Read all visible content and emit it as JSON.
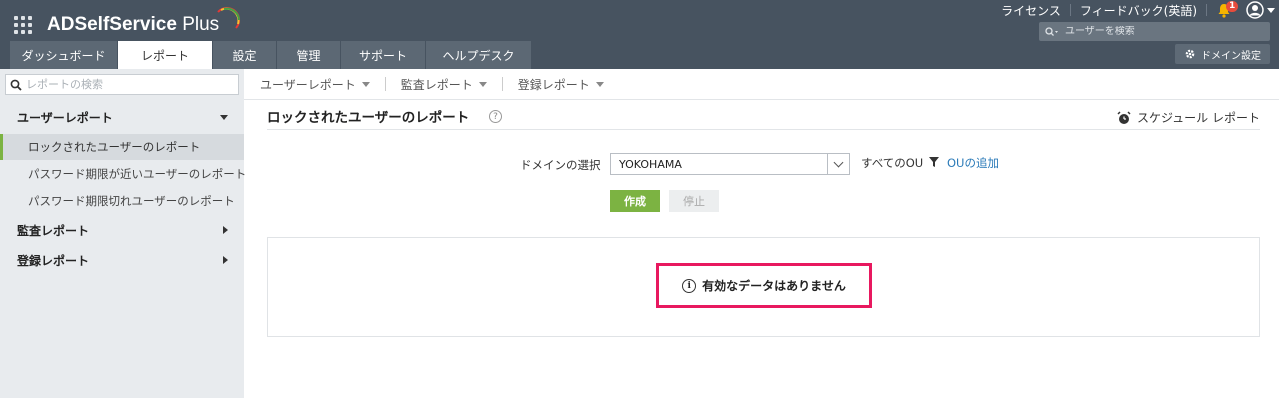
{
  "header": {
    "product_name": "ADSelfService",
    "product_suffix": "Plus",
    "links": {
      "license": "ライセンス",
      "feedback": "フィードバック(英語)"
    },
    "notification_count": "1",
    "user_search_placeholder": "ユーザーを検索",
    "domain_settings_label": "ドメイン設定",
    "tabs": [
      {
        "label": "ダッシュボード",
        "active": false
      },
      {
        "label": "レポート",
        "active": true
      },
      {
        "label": "設定",
        "active": false
      },
      {
        "label": "管理",
        "active": false
      },
      {
        "label": "サポート",
        "active": false
      },
      {
        "label": "ヘルプデスク",
        "active": false
      }
    ]
  },
  "sidebar": {
    "search_placeholder": "レポートの検索",
    "groups": [
      {
        "label": "ユーザーレポート",
        "expanded": true,
        "items": [
          {
            "label": "ロックされたユーザーのレポート",
            "active": true
          },
          {
            "label": "パスワード期限が近いユーザーのレポート",
            "active": false
          },
          {
            "label": "パスワード期限切れユーザーのレポート",
            "active": false
          }
        ]
      },
      {
        "label": "監査レポート",
        "expanded": false
      },
      {
        "label": "登録レポート",
        "expanded": false
      }
    ]
  },
  "subnav": {
    "items": [
      "ユーザーレポート",
      "監査レポート",
      "登録レポート"
    ]
  },
  "main": {
    "title": "ロックされたユーザーのレポート",
    "help_glyph": "?",
    "schedule_label": "スケジュール レポート",
    "domain_label": "ドメインの選択",
    "domain_value": "YOKOHAMA",
    "all_ou_label": "すべてのOU",
    "add_ou_label": "OUの追加",
    "create_button": "作成",
    "stop_button": "停止",
    "no_data_message": "有効なデータはありません",
    "info_glyph": "i"
  },
  "colors": {
    "header_bg": "#475360",
    "tab_bg": "#5c6874",
    "sidebar_bg": "#e8ebee",
    "accent_green": "#7cb342",
    "link_blue": "#2a7ab8",
    "highlight_pink": "#e8185f",
    "notification_red": "#e74c3c"
  }
}
